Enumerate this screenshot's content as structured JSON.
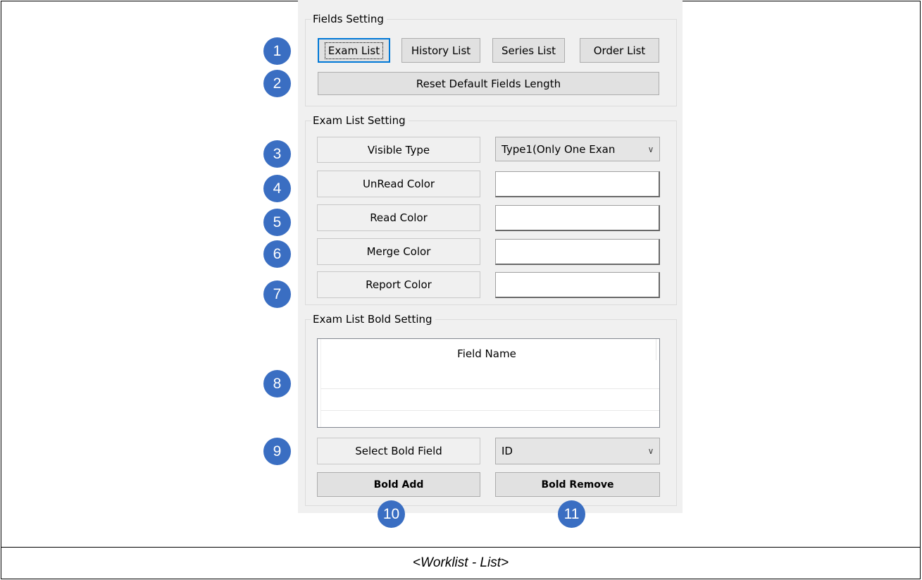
{
  "caption": "<Worklist - List>",
  "fields_setting": {
    "title": "Fields Setting",
    "buttons": [
      "Exam List",
      "History List",
      "Series List",
      "Order List"
    ],
    "reset_label": "Reset Default Fields Length"
  },
  "exam_list_setting": {
    "title": "Exam List Setting",
    "visible_type_label": "Visible Type",
    "visible_type_value": "Type1(Only One Exan",
    "unread_label": "UnRead Color",
    "read_label": "Read Color",
    "merge_label": "Merge Color",
    "report_label": "Report Color"
  },
  "bold_setting": {
    "title": "Exam List Bold Setting",
    "column_header": "Field Name",
    "select_label": "Select Bold Field",
    "select_value": "ID",
    "add_label": "Bold Add",
    "remove_label": "Bold Remove"
  },
  "badges": [
    "1",
    "2",
    "3",
    "4",
    "5",
    "6",
    "7",
    "8",
    "9",
    "10",
    "11"
  ],
  "colors": {
    "badge": "#3a6ec2",
    "panel": "#f0f0f0",
    "focus": "#0078d7"
  }
}
